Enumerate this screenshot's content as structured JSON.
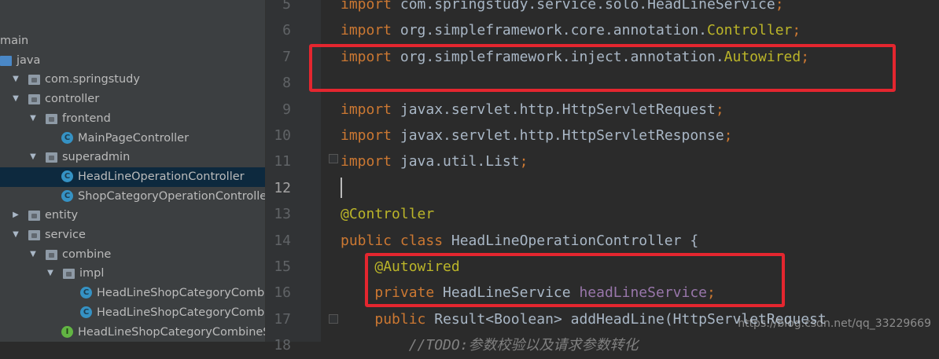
{
  "project_tree": {
    "items": [
      {
        "label": "main",
        "icon": "folder-icon",
        "arrow": ""
      },
      {
        "label": "java",
        "icon": "source-folder-icon",
        "arrow": ""
      },
      {
        "label": "com.springstudy",
        "icon": "package-icon",
        "arrow": "▼"
      },
      {
        "label": "controller",
        "icon": "package-icon",
        "arrow": "▼"
      },
      {
        "label": "frontend",
        "icon": "package-icon",
        "arrow": "▼"
      },
      {
        "label": "MainPageController",
        "icon": "class-icon",
        "arrow": ""
      },
      {
        "label": "superadmin",
        "icon": "package-icon",
        "arrow": "▼"
      },
      {
        "label": "HeadLineOperationController",
        "icon": "class-icon",
        "arrow": "",
        "selected": true
      },
      {
        "label": "ShopCategoryOperationController",
        "icon": "class-icon",
        "arrow": ""
      },
      {
        "label": "entity",
        "icon": "package-icon",
        "arrow": "▶"
      },
      {
        "label": "service",
        "icon": "package-icon",
        "arrow": "▼"
      },
      {
        "label": "combine",
        "icon": "package-icon",
        "arrow": "▼"
      },
      {
        "label": "impl",
        "icon": "package-icon",
        "arrow": "▼"
      },
      {
        "label": "HeadLineShopCategoryCombin",
        "icon": "class-icon",
        "arrow": ""
      },
      {
        "label": "HeadLineShopCategoryCombin",
        "icon": "class-icon",
        "arrow": ""
      },
      {
        "label": "HeadLineShopCategoryCombineSe",
        "icon": "interface-icon",
        "arrow": ""
      }
    ],
    "class_glyph": "C",
    "interface_glyph": "I"
  },
  "editor": {
    "current_line": "12",
    "lines": [
      {
        "num": "5",
        "parts": [
          {
            "t": "import",
            "c": "kw"
          },
          {
            "t": " com.springstudy.service.solo.HeadLineService"
          },
          {
            "t": ";",
            "c": "sem"
          }
        ]
      },
      {
        "num": "6",
        "parts": [
          {
            "t": "import",
            "c": "kw"
          },
          {
            "t": " org.simpleframework.core.annotation."
          },
          {
            "t": "Controller",
            "c": "ann"
          },
          {
            "t": ";",
            "c": "sem"
          }
        ]
      },
      {
        "num": "7",
        "parts": [
          {
            "t": "import",
            "c": "kw"
          },
          {
            "t": " org.simpleframework.inject.annotation."
          },
          {
            "t": "Autowired",
            "c": "ann"
          },
          {
            "t": ";",
            "c": "sem"
          }
        ]
      },
      {
        "num": "8",
        "parts": []
      },
      {
        "num": "9",
        "parts": [
          {
            "t": "import",
            "c": "kw"
          },
          {
            "t": " javax.servlet.http.HttpServletRequest"
          },
          {
            "t": ";",
            "c": "sem"
          }
        ]
      },
      {
        "num": "10",
        "parts": [
          {
            "t": "import",
            "c": "kw"
          },
          {
            "t": " javax.servlet.http.HttpServletResponse"
          },
          {
            "t": ";",
            "c": "sem"
          }
        ]
      },
      {
        "num": "11",
        "parts": [
          {
            "t": "import",
            "c": "kw"
          },
          {
            "t": " java.util.List"
          },
          {
            "t": ";",
            "c": "sem"
          }
        ]
      },
      {
        "num": "12",
        "parts": []
      },
      {
        "num": "13",
        "parts": [
          {
            "t": "@Controller",
            "c": "ann"
          }
        ]
      },
      {
        "num": "14",
        "parts": [
          {
            "t": "public class",
            "c": "kw"
          },
          {
            "t": " HeadLineOperationController {"
          }
        ]
      },
      {
        "num": "15",
        "parts": [
          {
            "t": "    "
          },
          {
            "t": "@Autowired",
            "c": "ann"
          }
        ]
      },
      {
        "num": "16",
        "parts": [
          {
            "t": "    "
          },
          {
            "t": "private",
            "c": "kw"
          },
          {
            "t": " HeadLineService "
          },
          {
            "t": "headLineService",
            "c": "fld"
          },
          {
            "t": ";",
            "c": "sem"
          }
        ]
      },
      {
        "num": "17",
        "parts": [
          {
            "t": "    "
          },
          {
            "t": "public",
            "c": "kw"
          },
          {
            "t": " Result<Boolean> addHeadLine(HttpServletRequest"
          }
        ]
      },
      {
        "num": "18",
        "parts": [
          {
            "t": "        "
          },
          {
            "t": "//TODO:参数校验以及请求参数转化",
            "c": "cmt"
          }
        ]
      }
    ]
  },
  "watermark": "https://blog.csdn.net/qq_33229669",
  "colors": {
    "keyword": "#cc7832",
    "annotation": "#bbb529",
    "field": "#9876aa",
    "highlight_box": "#e4262f",
    "selection": "#0d293e"
  }
}
